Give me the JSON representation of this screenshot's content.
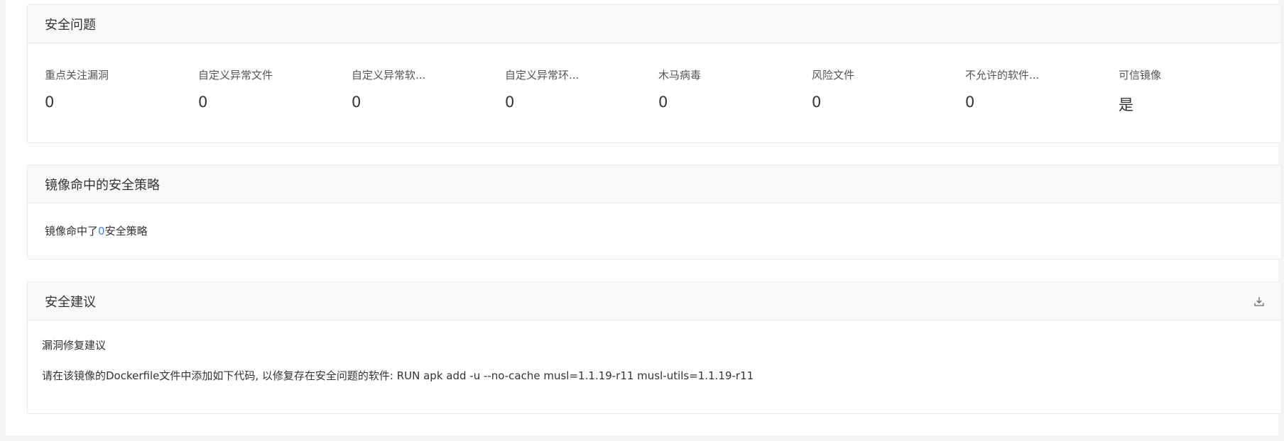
{
  "issues": {
    "title": "安全问题",
    "stats": [
      {
        "label": "重点关注漏洞",
        "value": "0"
      },
      {
        "label": "自定义异常文件",
        "value": "0"
      },
      {
        "label": "自定义异常软...",
        "value": "0"
      },
      {
        "label": "自定义异常环...",
        "value": "0"
      },
      {
        "label": "木马病毒",
        "value": "0"
      },
      {
        "label": "风险文件",
        "value": "0"
      },
      {
        "label": "不允许的软件...",
        "value": "0"
      },
      {
        "label": "可信镜像",
        "value": "是"
      }
    ]
  },
  "policy": {
    "title": "镜像命中的安全策略",
    "text_prefix": "镜像命中了",
    "count": "0",
    "text_suffix": "安全策略"
  },
  "advice": {
    "title": "安全建议",
    "download_icon": "download-icon",
    "section_title": "漏洞修复建议",
    "text": "请在该镜像的Dockerfile文件中添加如下代码, 以修复存在安全问题的软件: RUN apk add -u --no-cache musl=1.1.19-r11 musl-utils=1.1.19-r11"
  }
}
